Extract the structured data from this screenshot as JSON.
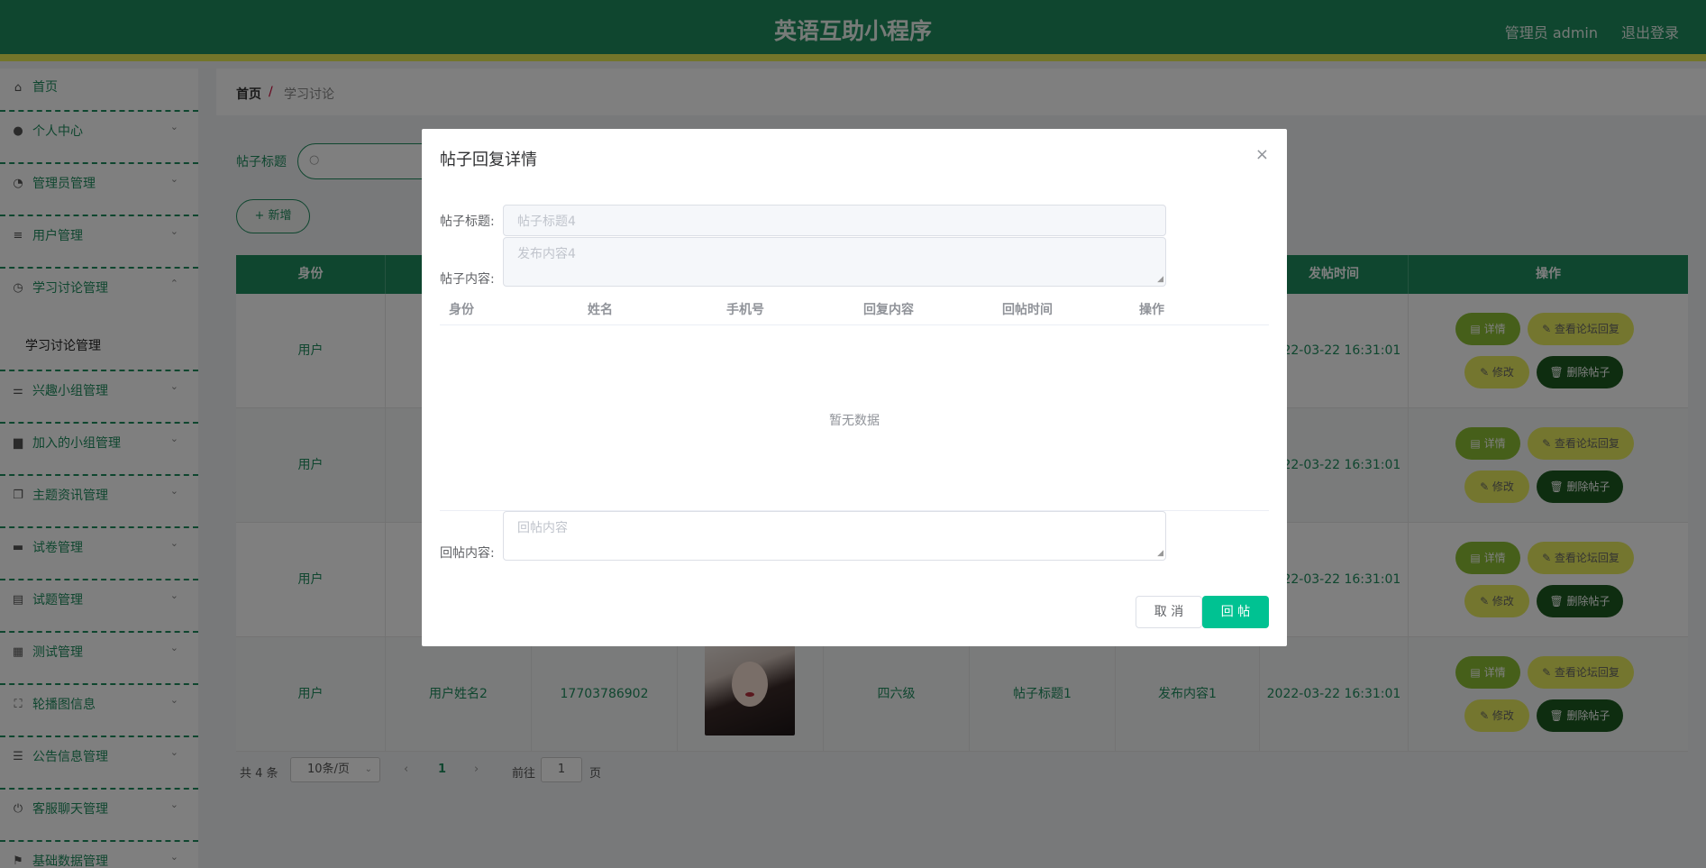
{
  "header": {
    "title": "英语互助小程序",
    "admin": "管理员 admin",
    "logout": "退出登录"
  },
  "sidebar": {
    "items": [
      {
        "label": "首页",
        "icon": "home-icon",
        "glyph": "⌂"
      },
      {
        "label": "个人中心",
        "icon": "user-icon",
        "glyph": "●"
      },
      {
        "label": "管理员管理",
        "icon": "speedometer-icon",
        "glyph": "◔"
      },
      {
        "label": "用户管理",
        "icon": "list-icon",
        "glyph": "≡"
      },
      {
        "label": "学习讨论管理",
        "icon": "clock-icon",
        "glyph": "◷"
      },
      {
        "label": "兴趣小组管理",
        "icon": "sliders-icon",
        "glyph": "⚌"
      },
      {
        "label": "加入的小组管理",
        "icon": "printer-icon",
        "glyph": "▆"
      },
      {
        "label": "主题资讯管理",
        "icon": "copy-icon",
        "glyph": "❐"
      },
      {
        "label": "试卷管理",
        "icon": "briefcase-icon",
        "glyph": "▬"
      },
      {
        "label": "试题管理",
        "icon": "clipboard-icon",
        "glyph": "▤"
      },
      {
        "label": "测试管理",
        "icon": "grid-icon",
        "glyph": "▦"
      },
      {
        "label": "轮播图信息",
        "icon": "fullscreen-icon",
        "glyph": "⛶"
      },
      {
        "label": "公告信息管理",
        "icon": "menu-icon",
        "glyph": "☰"
      },
      {
        "label": "客服聊天管理",
        "icon": "power-icon",
        "glyph": "⏻"
      },
      {
        "label": "基础数据管理",
        "icon": "flag-icon",
        "glyph": "⚑"
      }
    ],
    "submenu": {
      "label": "学习讨论管理"
    }
  },
  "breadcrumb": {
    "home": "首页",
    "separator": "/",
    "current": "学习讨论"
  },
  "search": {
    "label": "帖子标题",
    "placeholder": ""
  },
  "toolbar": {
    "add_label": "+ 新增"
  },
  "table": {
    "headers": {
      "first": "身份",
      "post_time": "发帖时间",
      "actions": "操作"
    },
    "rows": [
      {
        "role": "用户",
        "time": "2022-03-22 16:31:01"
      },
      {
        "role": "用户",
        "time": "2022-03-22 16:31:01"
      },
      {
        "role": "用户",
        "time": "2022-03-22 16:31:01"
      },
      {
        "role": "用户",
        "name": "用户姓名2",
        "phone": "17703786902",
        "level": "四六级",
        "title": "帖子标题1",
        "content": "发布内容1",
        "time": "2022-03-22 16:31:01"
      }
    ],
    "actions": {
      "detail": "▤ 详情",
      "view": "✎ 查看论坛回复",
      "edit": "✎ 修改",
      "delete": "🗑 删除帖子"
    }
  },
  "pager": {
    "total": "共 4 条",
    "page_size": "10条/页",
    "prev": "‹",
    "current_page": "1",
    "next": "›",
    "goto": "前往",
    "goto_value": "1",
    "page_suffix": "页"
  },
  "dialog": {
    "title": "帖子回复详情",
    "close": "×",
    "post_title_label": "帖子标题:",
    "post_title_value": "帖子标题4",
    "post_content_label": "帖子内容:",
    "post_content_value": "发布内容4",
    "reply_table_headers": [
      "身份",
      "姓名",
      "手机号",
      "回复内容",
      "回帖时间",
      "操作"
    ],
    "empty_text": "暂无数据",
    "reply_label": "回帖内容:",
    "reply_placeholder": "回帖内容",
    "cancel": "取 消",
    "submit": "回 帖"
  },
  "colors": {
    "primary": "#1f8c5e",
    "accent": "#e7eb55",
    "submit": "#00c292"
  }
}
